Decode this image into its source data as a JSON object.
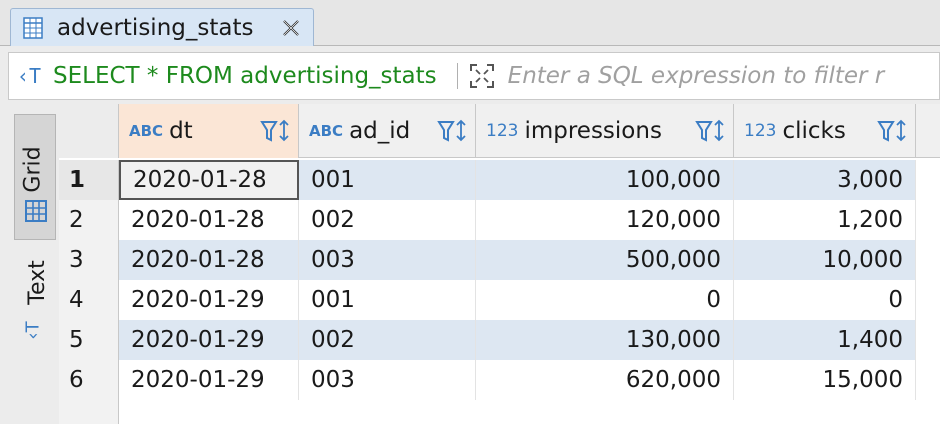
{
  "tab": {
    "title": "advertising_stats"
  },
  "filter": {
    "sql": "SELECT * FROM advertising_stats",
    "placeholder": "Enter a SQL expression to filter r"
  },
  "side_tabs": {
    "grid": "Grid",
    "text": "Text"
  },
  "columns": [
    {
      "type": "ABC",
      "name": "dt"
    },
    {
      "type": "ABC",
      "name": "ad_id"
    },
    {
      "type": "123",
      "name": "impressions"
    },
    {
      "type": "123",
      "name": "clicks"
    }
  ],
  "rows": [
    {
      "n": "1",
      "dt": "2020-01-28",
      "ad_id": "001",
      "impressions": "100,000",
      "clicks": "3,000"
    },
    {
      "n": "2",
      "dt": "2020-01-28",
      "ad_id": "002",
      "impressions": "120,000",
      "clicks": "1,200"
    },
    {
      "n": "3",
      "dt": "2020-01-28",
      "ad_id": "003",
      "impressions": "500,000",
      "clicks": "10,000"
    },
    {
      "n": "4",
      "dt": "2020-01-29",
      "ad_id": "001",
      "impressions": "0",
      "clicks": "0"
    },
    {
      "n": "5",
      "dt": "2020-01-29",
      "ad_id": "002",
      "impressions": "130,000",
      "clicks": "1,400"
    },
    {
      "n": "6",
      "dt": "2020-01-29",
      "ad_id": "003",
      "impressions": "620,000",
      "clicks": "15,000"
    }
  ],
  "colors": {
    "accent": "#3b7dc4",
    "sql_green": "#1d8a1d",
    "row_alt": "#dde7f2",
    "active_header": "#fbe6d6"
  }
}
